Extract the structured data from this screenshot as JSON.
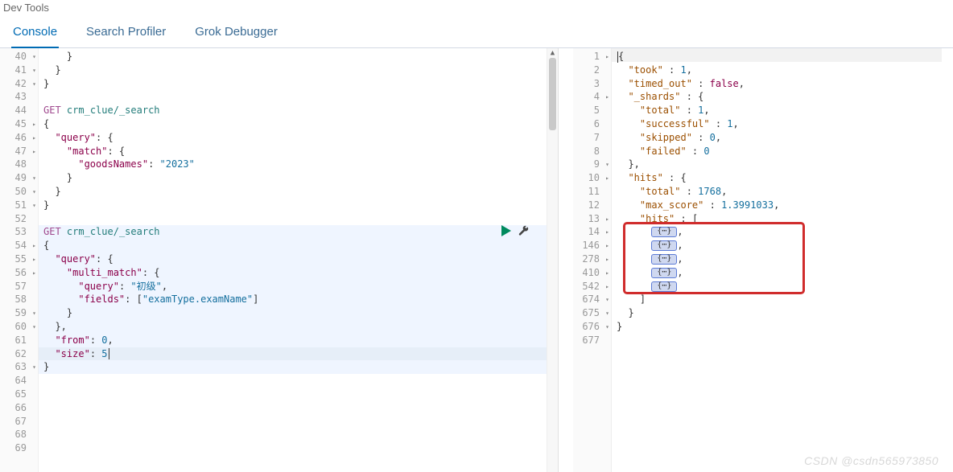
{
  "app_title": "Dev Tools",
  "tabs": {
    "console": "Console",
    "search_profiler": "Search Profiler",
    "grok_debugger": "Grok Debugger"
  },
  "left_editor": {
    "first_line_number": 40,
    "active_request_start": 53,
    "active_request_end": 63,
    "cursor_line": 62,
    "lines": [
      {
        "num": 40,
        "fold": "down",
        "tokens": [
          {
            "t": "    }",
            "c": ""
          }
        ]
      },
      {
        "num": 41,
        "fold": "down",
        "tokens": [
          {
            "t": "  }",
            "c": ""
          }
        ]
      },
      {
        "num": 42,
        "fold": "down",
        "tokens": [
          {
            "t": "}",
            "c": ""
          }
        ]
      },
      {
        "num": 43,
        "tokens": []
      },
      {
        "num": 44,
        "tokens": [
          {
            "t": "GET",
            "c": "k-method"
          },
          {
            "t": " ",
            "c": ""
          },
          {
            "t": "crm_clue/_search",
            "c": "k-path"
          }
        ]
      },
      {
        "num": 45,
        "fold": "right",
        "tokens": [
          {
            "t": "{",
            "c": ""
          }
        ]
      },
      {
        "num": 46,
        "fold": "right",
        "tokens": [
          {
            "t": "  ",
            "c": ""
          },
          {
            "t": "\"query\"",
            "c": "k-key"
          },
          {
            "t": ": {",
            "c": ""
          }
        ]
      },
      {
        "num": 47,
        "fold": "right",
        "tokens": [
          {
            "t": "    ",
            "c": ""
          },
          {
            "t": "\"match\"",
            "c": "k-key"
          },
          {
            "t": ": {",
            "c": ""
          }
        ]
      },
      {
        "num": 48,
        "tokens": [
          {
            "t": "      ",
            "c": ""
          },
          {
            "t": "\"goodsNames\"",
            "c": "k-key"
          },
          {
            "t": ": ",
            "c": ""
          },
          {
            "t": "\"2023\"",
            "c": "k-str"
          }
        ]
      },
      {
        "num": 49,
        "fold": "down",
        "tokens": [
          {
            "t": "    }",
            "c": ""
          }
        ]
      },
      {
        "num": 50,
        "fold": "down",
        "tokens": [
          {
            "t": "  }",
            "c": ""
          }
        ]
      },
      {
        "num": 51,
        "fold": "down",
        "tokens": [
          {
            "t": "}",
            "c": ""
          }
        ]
      },
      {
        "num": 52,
        "tokens": []
      },
      {
        "num": 53,
        "tokens": [
          {
            "t": "GET",
            "c": "k-method"
          },
          {
            "t": " ",
            "c": ""
          },
          {
            "t": "crm_clue/_search",
            "c": "k-path"
          }
        ]
      },
      {
        "num": 54,
        "fold": "right",
        "tokens": [
          {
            "t": "{",
            "c": ""
          }
        ]
      },
      {
        "num": 55,
        "fold": "right",
        "tokens": [
          {
            "t": "  ",
            "c": ""
          },
          {
            "t": "\"query\"",
            "c": "k-key"
          },
          {
            "t": ": {",
            "c": ""
          }
        ]
      },
      {
        "num": 56,
        "fold": "right",
        "tokens": [
          {
            "t": "    ",
            "c": ""
          },
          {
            "t": "\"multi_match\"",
            "c": "k-key"
          },
          {
            "t": ": {",
            "c": ""
          }
        ]
      },
      {
        "num": 57,
        "tokens": [
          {
            "t": "      ",
            "c": ""
          },
          {
            "t": "\"query\"",
            "c": "k-key"
          },
          {
            "t": ": ",
            "c": ""
          },
          {
            "t": "\"初级\"",
            "c": "k-str"
          },
          {
            "t": ",",
            "c": ""
          }
        ]
      },
      {
        "num": 58,
        "tokens": [
          {
            "t": "      ",
            "c": ""
          },
          {
            "t": "\"fields\"",
            "c": "k-key"
          },
          {
            "t": ": [",
            "c": ""
          },
          {
            "t": "\"examType.examName\"",
            "c": "k-str"
          },
          {
            "t": "]",
            "c": ""
          }
        ]
      },
      {
        "num": 59,
        "fold": "down",
        "tokens": [
          {
            "t": "    }",
            "c": ""
          }
        ]
      },
      {
        "num": 60,
        "fold": "down",
        "tokens": [
          {
            "t": "  },",
            "c": ""
          }
        ]
      },
      {
        "num": 61,
        "tokens": [
          {
            "t": "  ",
            "c": ""
          },
          {
            "t": "\"from\"",
            "c": "k-key"
          },
          {
            "t": ": ",
            "c": ""
          },
          {
            "t": "0",
            "c": "k-num"
          },
          {
            "t": ",",
            "c": ""
          }
        ]
      },
      {
        "num": 62,
        "tokens": [
          {
            "t": "  ",
            "c": ""
          },
          {
            "t": "\"size\"",
            "c": "k-key"
          },
          {
            "t": ": ",
            "c": ""
          },
          {
            "t": "5",
            "c": "k-num"
          }
        ],
        "cursor_after": true
      },
      {
        "num": 63,
        "fold": "down",
        "tokens": [
          {
            "t": "}",
            "c": ""
          }
        ]
      },
      {
        "num": 64,
        "tokens": []
      },
      {
        "num": 65,
        "tokens": []
      },
      {
        "num": 66,
        "tokens": []
      },
      {
        "num": 67,
        "tokens": []
      },
      {
        "num": 68,
        "tokens": []
      },
      {
        "num": 69,
        "tokens": []
      }
    ]
  },
  "right_editor": {
    "lines": [
      {
        "num": 1,
        "fold": "right",
        "tokens": [
          {
            "t": "{",
            "c": ""
          }
        ],
        "cursor_before": true
      },
      {
        "num": 2,
        "tokens": [
          {
            "t": "  ",
            "c": ""
          },
          {
            "t": "\"took\"",
            "c": "rk-key"
          },
          {
            "t": " : ",
            "c": ""
          },
          {
            "t": "1",
            "c": "rk-num"
          },
          {
            "t": ",",
            "c": ""
          }
        ]
      },
      {
        "num": 3,
        "tokens": [
          {
            "t": "  ",
            "c": ""
          },
          {
            "t": "\"timed_out\"",
            "c": "rk-key"
          },
          {
            "t": " : ",
            "c": ""
          },
          {
            "t": "false",
            "c": "rk-bool"
          },
          {
            "t": ",",
            "c": ""
          }
        ]
      },
      {
        "num": 4,
        "fold": "right",
        "tokens": [
          {
            "t": "  ",
            "c": ""
          },
          {
            "t": "\"_shards\"",
            "c": "rk-key"
          },
          {
            "t": " : {",
            "c": ""
          }
        ]
      },
      {
        "num": 5,
        "tokens": [
          {
            "t": "    ",
            "c": ""
          },
          {
            "t": "\"total\"",
            "c": "rk-key"
          },
          {
            "t": " : ",
            "c": ""
          },
          {
            "t": "1",
            "c": "rk-num"
          },
          {
            "t": ",",
            "c": ""
          }
        ]
      },
      {
        "num": 6,
        "tokens": [
          {
            "t": "    ",
            "c": ""
          },
          {
            "t": "\"successful\"",
            "c": "rk-key"
          },
          {
            "t": " : ",
            "c": ""
          },
          {
            "t": "1",
            "c": "rk-num"
          },
          {
            "t": ",",
            "c": ""
          }
        ]
      },
      {
        "num": 7,
        "tokens": [
          {
            "t": "    ",
            "c": ""
          },
          {
            "t": "\"skipped\"",
            "c": "rk-key"
          },
          {
            "t": " : ",
            "c": ""
          },
          {
            "t": "0",
            "c": "rk-num"
          },
          {
            "t": ",",
            "c": ""
          }
        ]
      },
      {
        "num": 8,
        "tokens": [
          {
            "t": "    ",
            "c": ""
          },
          {
            "t": "\"failed\"",
            "c": "rk-key"
          },
          {
            "t": " : ",
            "c": ""
          },
          {
            "t": "0",
            "c": "rk-num"
          }
        ]
      },
      {
        "num": 9,
        "fold": "down",
        "tokens": [
          {
            "t": "  },",
            "c": ""
          }
        ]
      },
      {
        "num": 10,
        "fold": "right",
        "tokens": [
          {
            "t": "  ",
            "c": ""
          },
          {
            "t": "\"hits\"",
            "c": "rk-key"
          },
          {
            "t": " : {",
            "c": ""
          }
        ]
      },
      {
        "num": 11,
        "tokens": [
          {
            "t": "    ",
            "c": ""
          },
          {
            "t": "\"total\"",
            "c": "rk-key"
          },
          {
            "t": " : ",
            "c": ""
          },
          {
            "t": "1768",
            "c": "rk-num"
          },
          {
            "t": ",",
            "c": ""
          }
        ]
      },
      {
        "num": 12,
        "tokens": [
          {
            "t": "    ",
            "c": ""
          },
          {
            "t": "\"max_score\"",
            "c": "rk-key"
          },
          {
            "t": " : ",
            "c": ""
          },
          {
            "t": "1.3991033",
            "c": "rk-num"
          },
          {
            "t": ",",
            "c": ""
          }
        ]
      },
      {
        "num": 13,
        "fold": "right",
        "tokens": [
          {
            "t": "    ",
            "c": ""
          },
          {
            "t": "\"hits\"",
            "c": "rk-key"
          },
          {
            "t": " : [",
            "c": ""
          }
        ]
      },
      {
        "num": 14,
        "fold": "closed",
        "tokens": [
          {
            "t": "      ",
            "c": ""
          },
          {
            "collapsed": true
          },
          {
            "t": ",",
            "c": ""
          }
        ]
      },
      {
        "num": 146,
        "fold": "closed",
        "tokens": [
          {
            "t": "      ",
            "c": ""
          },
          {
            "collapsed": true
          },
          {
            "t": ",",
            "c": ""
          }
        ]
      },
      {
        "num": 278,
        "fold": "closed",
        "tokens": [
          {
            "t": "      ",
            "c": ""
          },
          {
            "collapsed": true
          },
          {
            "t": ",",
            "c": ""
          }
        ]
      },
      {
        "num": 410,
        "fold": "closed",
        "tokens": [
          {
            "t": "      ",
            "c": ""
          },
          {
            "collapsed": true
          },
          {
            "t": ",",
            "c": ""
          }
        ]
      },
      {
        "num": 542,
        "fold": "closed",
        "tokens": [
          {
            "t": "      ",
            "c": ""
          },
          {
            "collapsed": true
          }
        ]
      },
      {
        "num": 674,
        "fold": "down",
        "tokens": [
          {
            "t": "    ]",
            "c": ""
          }
        ]
      },
      {
        "num": 675,
        "fold": "down",
        "tokens": [
          {
            "t": "  }",
            "c": ""
          }
        ]
      },
      {
        "num": 676,
        "fold": "down",
        "tokens": [
          {
            "t": "}",
            "c": ""
          }
        ]
      },
      {
        "num": 677,
        "tokens": []
      }
    ],
    "redbox": {
      "start_index": 13,
      "end_index": 17
    }
  },
  "response_data": {
    "took": 1,
    "timed_out": false,
    "_shards": {
      "total": 1,
      "successful": 1,
      "skipped": 0,
      "failed": 0
    },
    "hits": {
      "total": 1768,
      "max_score": 1.3991033,
      "hits_count": 5
    }
  },
  "watermark": "CSDN @csdn565973850"
}
